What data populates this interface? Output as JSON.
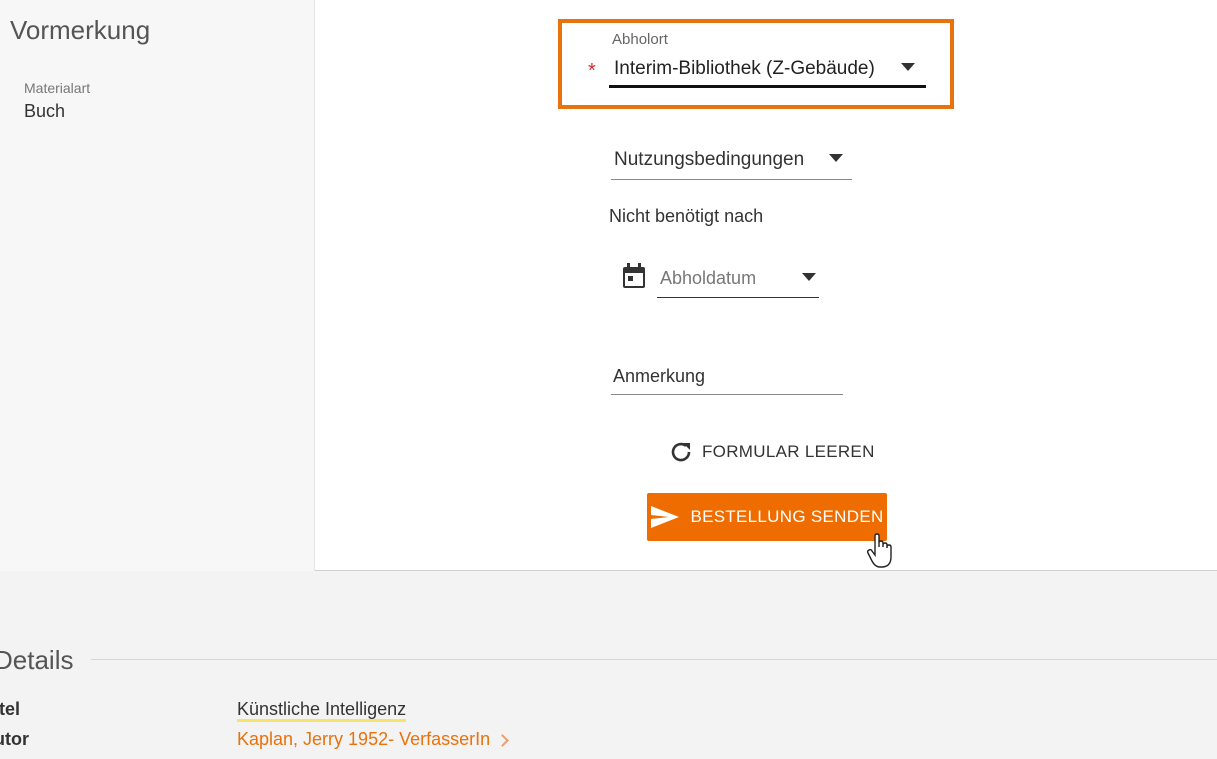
{
  "sidebar": {
    "title": "Vormerkung",
    "material_label": "Materialart",
    "material_value": "Buch"
  },
  "form": {
    "pickup": {
      "label": "Abholort",
      "required_mark": "*",
      "value": "Interim-Bibliothek (Z-Gebäude)"
    },
    "terms": {
      "value": "Nutzungsbedingungen"
    },
    "not_needed_label": "Nicht benötigt nach",
    "pickup_date": {
      "placeholder": "Abholdatum"
    },
    "note": {
      "placeholder": "Anmerkung"
    },
    "reset_label": "FORMULAR LEEREN",
    "submit_label": "BESTELLUNG SENDEN"
  },
  "details": {
    "title": "Details",
    "rows": [
      {
        "label": "itel",
        "value": "Künstliche Intelligenz"
      },
      {
        "label": "utor",
        "value": "Kaplan, Jerry 1952- VerfasserIn"
      }
    ]
  },
  "colors": {
    "accent": "#ef6c00",
    "highlight_border": "#e8720c",
    "required": "#d32f2f",
    "title_underline": "#f6e36d"
  }
}
